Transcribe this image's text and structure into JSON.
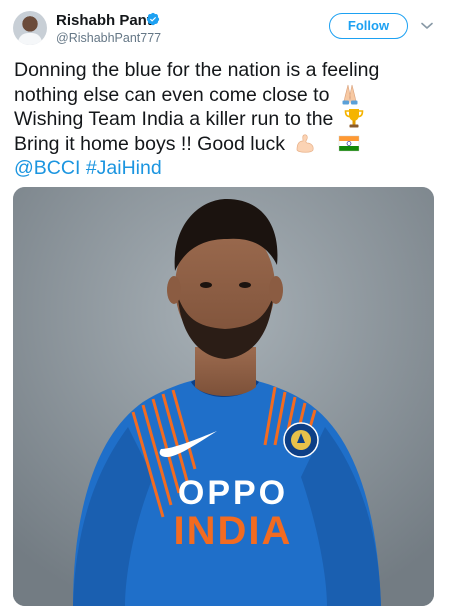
{
  "user": {
    "name": "Rishabh Pant",
    "handle": "@RishabhPant777",
    "verified_icon": "verified-badge-icon"
  },
  "actions": {
    "follow_label": "Follow",
    "more_icon": "chevron-down-icon"
  },
  "tweet": {
    "line1": "Donning the blue for the nation is a feeling",
    "line2": "nothing else can even come close to",
    "line3": "Wishing Team India a killer run to the",
    "line4": "Bring it home boys !! Good luck",
    "mention": "@BCCI",
    "hashtag": "#JaiHind",
    "emojis": [
      "folded-hands-icon",
      "trophy-icon",
      "flexed-biceps-icon",
      "india-flag-icon"
    ]
  },
  "photo": {
    "jersey_sponsor": "OPPO",
    "jersey_country": "INDIA"
  },
  "colors": {
    "link": "#1b95e0",
    "follow": "#1da1f2",
    "jersey_blue": "#1f6fc9",
    "jersey_orange": "#f26b21"
  }
}
